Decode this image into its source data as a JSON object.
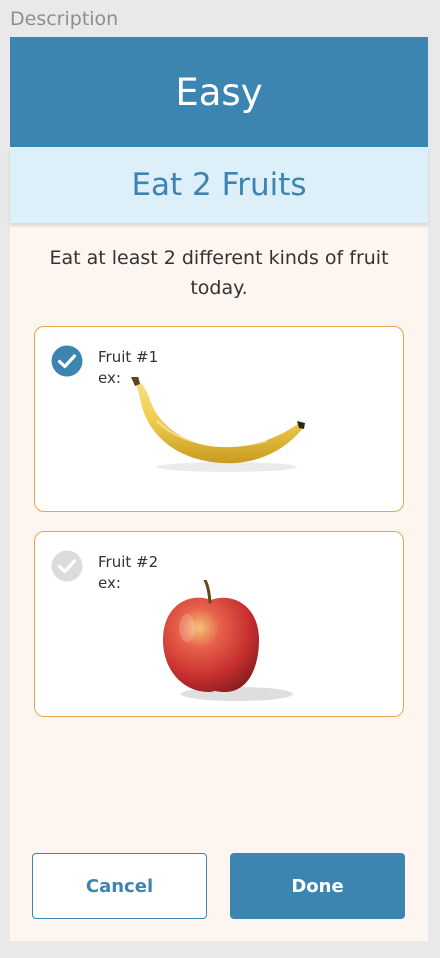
{
  "section_label": "Description",
  "challenge": {
    "level": "Easy",
    "title": "Eat 2 Fruits",
    "instructions": "Eat at least 2 different kinds of fruit today."
  },
  "fruits": [
    {
      "label": "Fruit #1",
      "example": "ex:",
      "checked": true,
      "image": "banana"
    },
    {
      "label": "Fruit #2",
      "example": "ex:",
      "checked": false,
      "image": "apple"
    }
  ],
  "buttons": {
    "cancel": "Cancel",
    "done": "Done"
  },
  "colors": {
    "primary": "#3d85b1",
    "light_banner": "#ddeff8",
    "card_bg": "#fdf5f0",
    "box_border": "#e8a64e",
    "check_inactive": "#dcdcdc"
  },
  "icons": {
    "checked": "check-circle-icon",
    "unchecked": "check-circle-outline-icon"
  }
}
